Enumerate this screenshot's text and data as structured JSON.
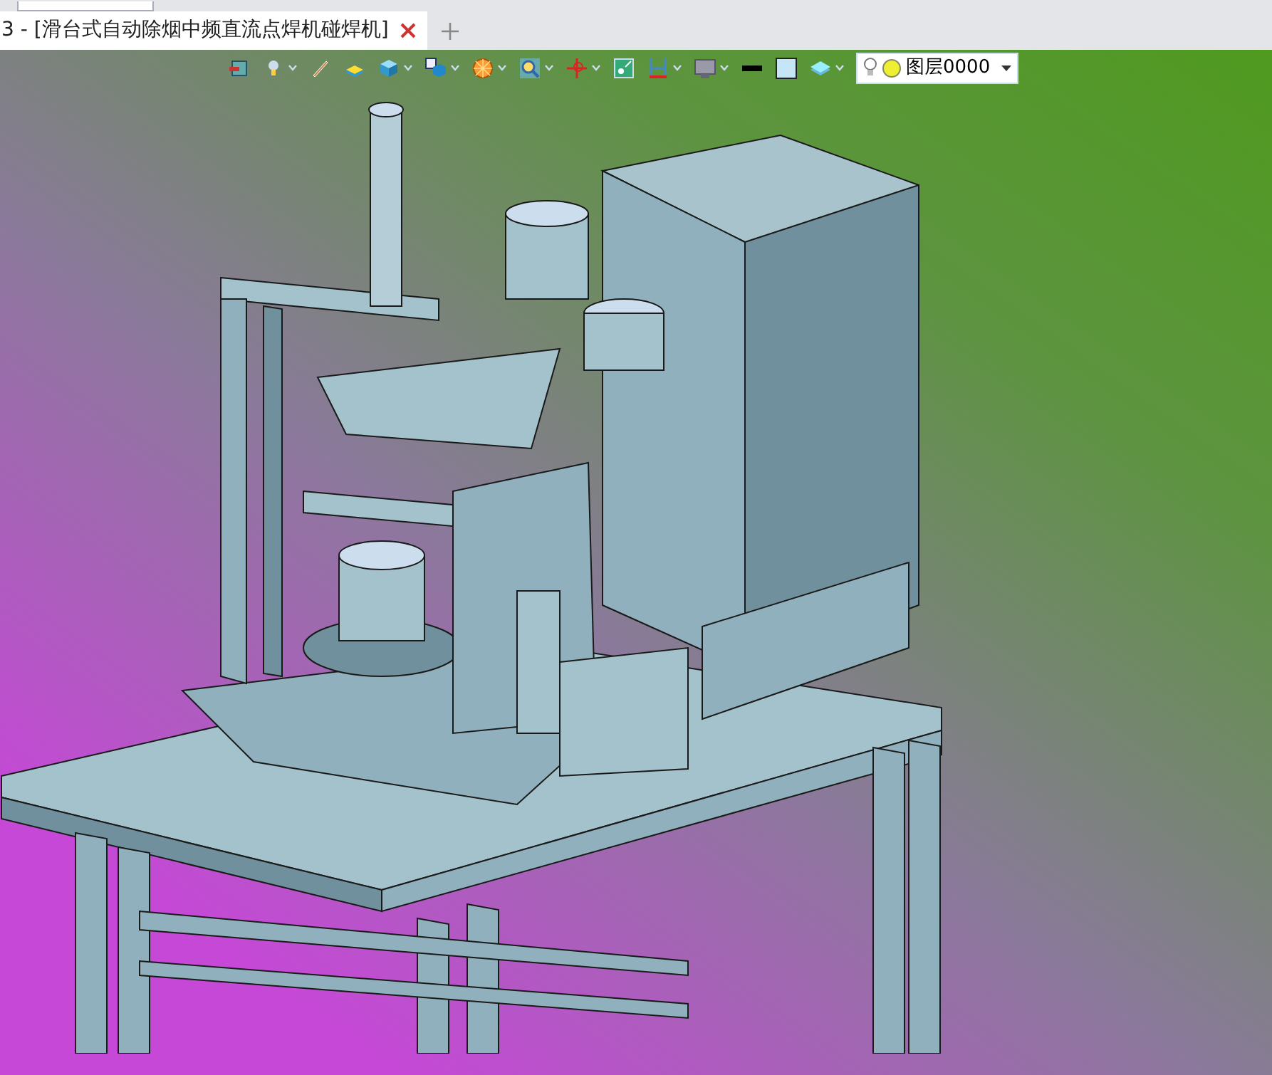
{
  "document_tab": {
    "title": "3 - [滑台式自动除烟中频直流点焊机碰焊机]",
    "selected": true
  },
  "layer_select": {
    "value": "图层0000"
  }
}
